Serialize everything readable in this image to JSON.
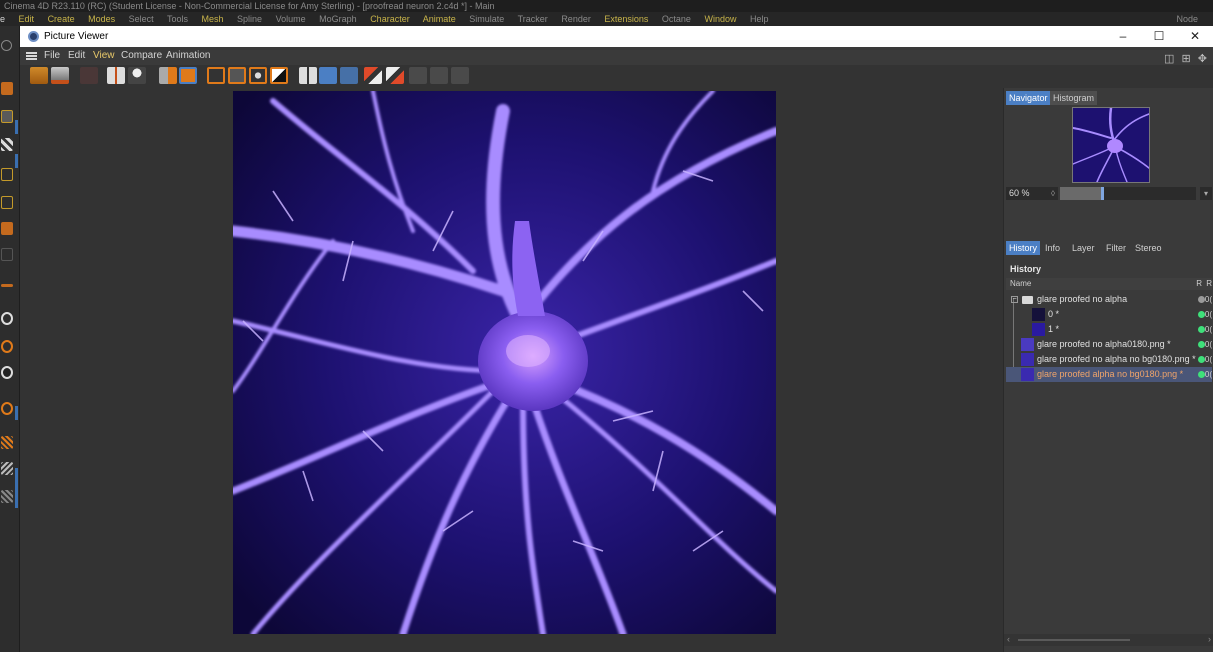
{
  "app": {
    "window_title": "Cinema 4D R23.110 (RC) (Student License - Non-Commercial License for Amy Sterling) - [proofread neuron 2.c4d *] - Main",
    "menu": [
      "e",
      "Edit",
      "Create",
      "Modes",
      "Select",
      "Tools",
      "Mesh",
      "Spline",
      "Volume",
      "MoGraph",
      "Character",
      "Animate",
      "Simulate",
      "Tracker",
      "Render",
      "Extensions",
      "Octane",
      "Window",
      "Help"
    ],
    "menu_right": "Node"
  },
  "picture_viewer": {
    "title": "Picture Viewer",
    "window_controls": {
      "minimize": "–",
      "maximize": "☐",
      "close": "✕"
    },
    "menu": [
      "File",
      "Edit",
      "View",
      "Compare",
      "Animation"
    ],
    "toolbar_right": "◫ ⊞ ✥"
  },
  "navigator": {
    "tabs": [
      "Navigator",
      "Histogram"
    ],
    "active_tab": "Navigator",
    "zoom_value": "60 %",
    "zoom_fraction": 0.6
  },
  "history_panel": {
    "tabs": [
      "History",
      "Info",
      "Layer",
      "Filter",
      "Stereo"
    ],
    "active_tab": "History",
    "heading": "History",
    "columns": {
      "name": "Name",
      "r": "R",
      "r2": "R"
    },
    "items": [
      {
        "name": "glare proofed no alpha",
        "status_color": "#9a9a9a",
        "value": "0("
      },
      {
        "name": "0 *",
        "status_color": "#3ee07a",
        "value": "0("
      },
      {
        "name": "1 *",
        "status_color": "#3ee07a",
        "value": "0("
      },
      {
        "name": "glare proofed no alpha0180.png *",
        "status_color": "#3ee07a",
        "value": "0("
      },
      {
        "name": "glare proofed no alpha no bg0180.png *",
        "status_color": "#3ee07a",
        "value": "0("
      },
      {
        "name": "glare proofed alpha no bg0180.png *",
        "status_color": "#3ee07a",
        "value": "0("
      }
    ],
    "selected_index": 5
  },
  "colors": {
    "accent": "#4b7fc4",
    "selected_text": "#f0a46a",
    "render_bg": "#1a0f55"
  }
}
